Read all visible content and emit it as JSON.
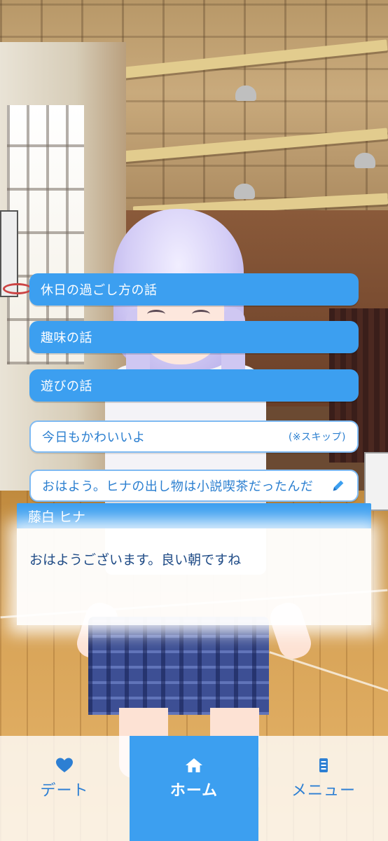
{
  "choices": [
    {
      "label": "休日の過ごし方の話"
    },
    {
      "label": "趣味の話"
    },
    {
      "label": "遊びの話"
    },
    {
      "label": "今日もかわいいよ",
      "note": "(※スキップ)"
    },
    {
      "label": "おはよう。ヒナの出し物は小説喫茶だったんだ",
      "icon": "pencil-icon"
    }
  ],
  "dialogue": {
    "speaker": "藤白 ヒナ",
    "text": "おはようございます。良い朝ですね"
  },
  "nav": {
    "items": [
      {
        "label": "デート",
        "icon": "heart-icon"
      },
      {
        "label": "ホーム",
        "icon": "home-icon",
        "active": true
      },
      {
        "label": "メニュー",
        "icon": "menu-list-icon"
      }
    ]
  },
  "colors": {
    "accent_blue": "#3c9ff0",
    "text_blue": "#2b7fd0",
    "dialog_text": "#1f4b86"
  }
}
